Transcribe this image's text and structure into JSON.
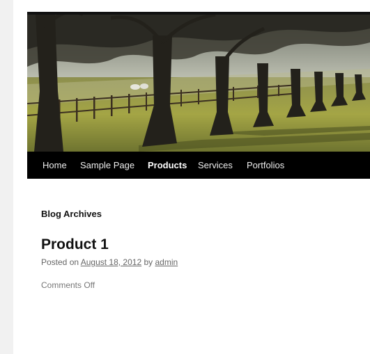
{
  "nav": {
    "items": [
      {
        "label": "Home"
      },
      {
        "label": "Sample Page"
      },
      {
        "label": "Products"
      },
      {
        "label": "Services"
      },
      {
        "label": "Portfolios"
      }
    ],
    "active_item": "Products"
  },
  "archive": {
    "title": "Blog Archives"
  },
  "post": {
    "title": "Product 1",
    "posted_on_label": "Posted on",
    "date": "August 18, 2012",
    "by_label": "by",
    "author": "admin",
    "comments": "Comments Off"
  },
  "colors": {
    "nav_background": "#000000",
    "gutter": "#f1f1f1",
    "text_meta": "#666666"
  },
  "header_image": {
    "subject": "row of trees along a wooden fence with sheep in a misty field"
  }
}
